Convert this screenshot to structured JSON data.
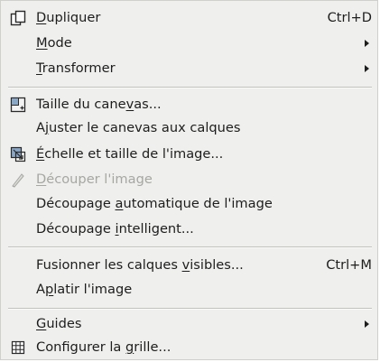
{
  "menu": {
    "items": [
      {
        "pre": "",
        "ul": "D",
        "post": "upliquer",
        "shortcut": "Ctrl+D",
        "icon": "duplicate-icon"
      },
      {
        "pre": "",
        "ul": "M",
        "post": "ode",
        "submenu": true
      },
      {
        "pre": "",
        "ul": "T",
        "post": "ransformer",
        "submenu": true
      },
      {
        "pre": "Taille du cane",
        "ul": "v",
        "post": "as...",
        "icon": "canvas-size-icon"
      },
      {
        "pre": "A",
        "ul": "j",
        "post": "uster le canevas aux calques"
      },
      {
        "pre": "",
        "ul": "É",
        "post": "chelle et taille de l'image...",
        "icon": "image-scale-icon"
      },
      {
        "pre": "",
        "ul": "D",
        "post": "écouper l'image",
        "disabled": true,
        "icon": "crop-icon"
      },
      {
        "pre": "Découpage ",
        "ul": "a",
        "post": "utomatique de l'image"
      },
      {
        "pre": "Découpage ",
        "ul": "i",
        "post": "ntelligent..."
      },
      {
        "pre": "Fusionner les calques ",
        "ul": "v",
        "post": "isibles...",
        "shortcut": "Ctrl+M"
      },
      {
        "pre": "A",
        "ul": "p",
        "post": "latir l'image"
      },
      {
        "pre": "",
        "ul": "G",
        "post": "uides",
        "submenu": true
      },
      {
        "pre": "Configurer la ",
        "ul": "g",
        "post": "rille...",
        "icon": "grid-icon"
      }
    ]
  }
}
